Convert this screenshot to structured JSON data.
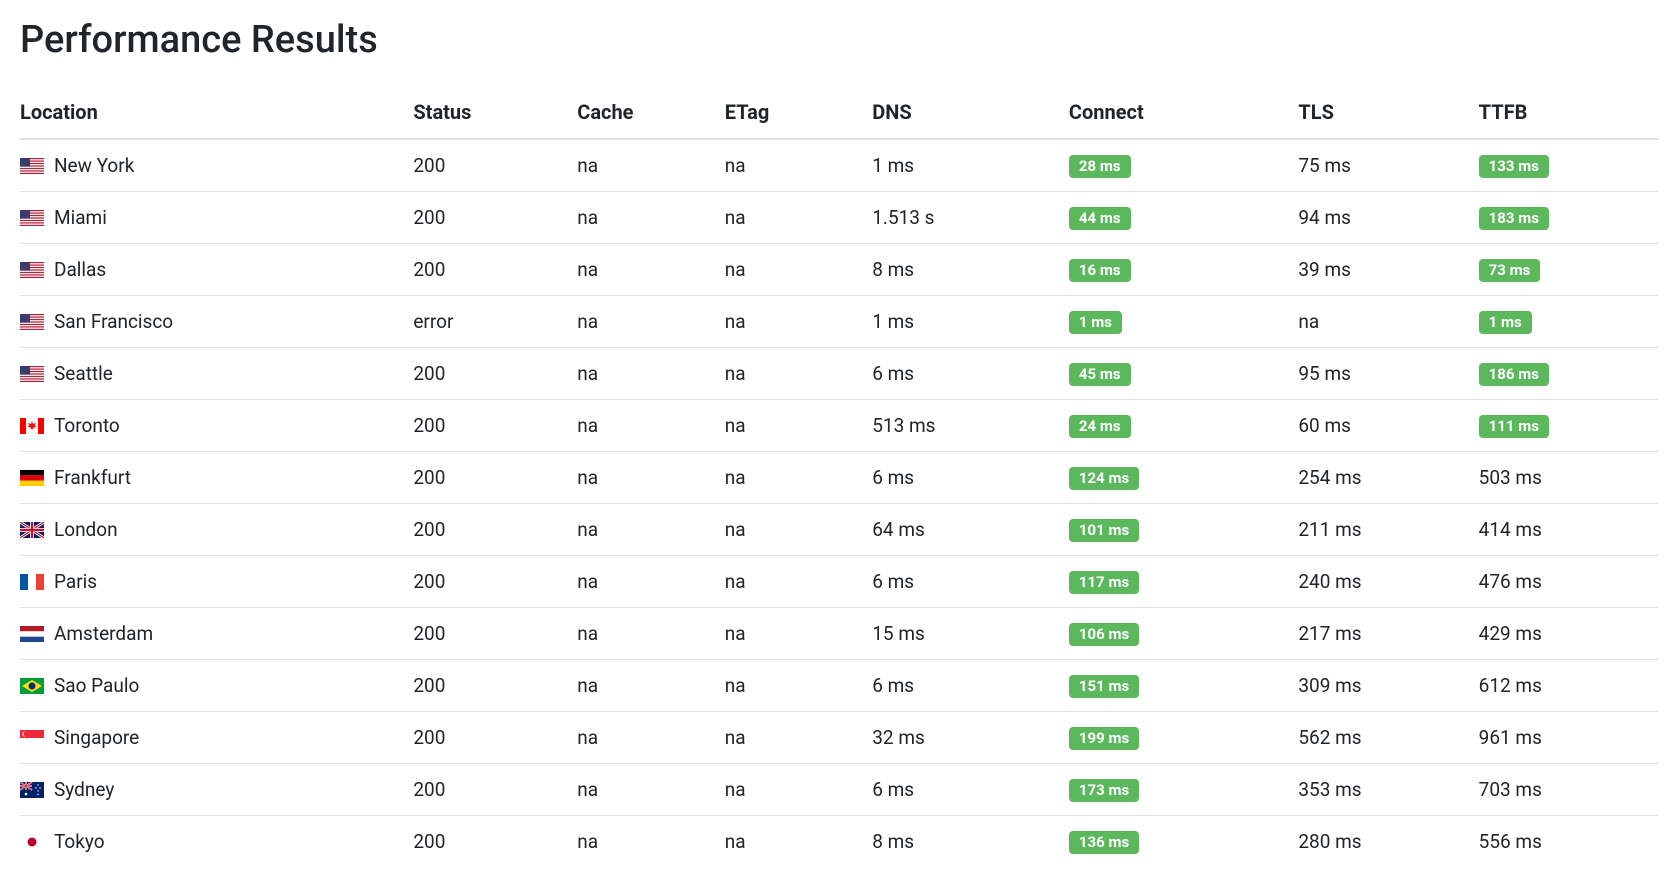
{
  "title": "Performance Results",
  "columns": [
    "Location",
    "Status",
    "Cache",
    "ETag",
    "DNS",
    "Connect",
    "TLS",
    "TTFB"
  ],
  "rows": [
    {
      "flag": "us",
      "location": "New York",
      "status": "200",
      "cache": "na",
      "etag": "na",
      "dns": "1 ms",
      "connect": "28 ms",
      "connect_badge": "green",
      "tls": "75 ms",
      "ttfb": "133 ms",
      "ttfb_badge": "green"
    },
    {
      "flag": "us",
      "location": "Miami",
      "status": "200",
      "cache": "na",
      "etag": "na",
      "dns": "1.513 s",
      "connect": "44 ms",
      "connect_badge": "green",
      "tls": "94 ms",
      "ttfb": "183 ms",
      "ttfb_badge": "green"
    },
    {
      "flag": "us",
      "location": "Dallas",
      "status": "200",
      "cache": "na",
      "etag": "na",
      "dns": "8 ms",
      "connect": "16 ms",
      "connect_badge": "green",
      "tls": "39 ms",
      "ttfb": "73 ms",
      "ttfb_badge": "green"
    },
    {
      "flag": "us",
      "location": "San Francisco",
      "status": "error",
      "cache": "na",
      "etag": "na",
      "dns": "1 ms",
      "connect": "1 ms",
      "connect_badge": "green",
      "tls": "na",
      "ttfb": "1 ms",
      "ttfb_badge": "green"
    },
    {
      "flag": "us",
      "location": "Seattle",
      "status": "200",
      "cache": "na",
      "etag": "na",
      "dns": "6 ms",
      "connect": "45 ms",
      "connect_badge": "green",
      "tls": "95 ms",
      "ttfb": "186 ms",
      "ttfb_badge": "green"
    },
    {
      "flag": "ca",
      "location": "Toronto",
      "status": "200",
      "cache": "na",
      "etag": "na",
      "dns": "513 ms",
      "connect": "24 ms",
      "connect_badge": "green",
      "tls": "60 ms",
      "ttfb": "111 ms",
      "ttfb_badge": "green"
    },
    {
      "flag": "de",
      "location": "Frankfurt",
      "status": "200",
      "cache": "na",
      "etag": "na",
      "dns": "6 ms",
      "connect": "124 ms",
      "connect_badge": "green",
      "tls": "254 ms",
      "ttfb": "503 ms",
      "ttfb_badge": ""
    },
    {
      "flag": "gb",
      "location": "London",
      "status": "200",
      "cache": "na",
      "etag": "na",
      "dns": "64 ms",
      "connect": "101 ms",
      "connect_badge": "green",
      "tls": "211 ms",
      "ttfb": "414 ms",
      "ttfb_badge": ""
    },
    {
      "flag": "fr",
      "location": "Paris",
      "status": "200",
      "cache": "na",
      "etag": "na",
      "dns": "6 ms",
      "connect": "117 ms",
      "connect_badge": "green",
      "tls": "240 ms",
      "ttfb": "476 ms",
      "ttfb_badge": ""
    },
    {
      "flag": "nl",
      "location": "Amsterdam",
      "status": "200",
      "cache": "na",
      "etag": "na",
      "dns": "15 ms",
      "connect": "106 ms",
      "connect_badge": "green",
      "tls": "217 ms",
      "ttfb": "429 ms",
      "ttfb_badge": ""
    },
    {
      "flag": "br",
      "location": "Sao Paulo",
      "status": "200",
      "cache": "na",
      "etag": "na",
      "dns": "6 ms",
      "connect": "151 ms",
      "connect_badge": "green",
      "tls": "309 ms",
      "ttfb": "612 ms",
      "ttfb_badge": ""
    },
    {
      "flag": "sg",
      "location": "Singapore",
      "status": "200",
      "cache": "na",
      "etag": "na",
      "dns": "32 ms",
      "connect": "199 ms",
      "connect_badge": "green",
      "tls": "562 ms",
      "ttfb": "961 ms",
      "ttfb_badge": ""
    },
    {
      "flag": "au",
      "location": "Sydney",
      "status": "200",
      "cache": "na",
      "etag": "na",
      "dns": "6 ms",
      "connect": "173 ms",
      "connect_badge": "green",
      "tls": "353 ms",
      "ttfb": "703 ms",
      "ttfb_badge": ""
    },
    {
      "flag": "jp",
      "location": "Tokyo",
      "status": "200",
      "cache": "na",
      "etag": "na",
      "dns": "8 ms",
      "connect": "136 ms",
      "connect_badge": "green",
      "tls": "280 ms",
      "ttfb": "556 ms",
      "ttfb_badge": ""
    }
  ]
}
